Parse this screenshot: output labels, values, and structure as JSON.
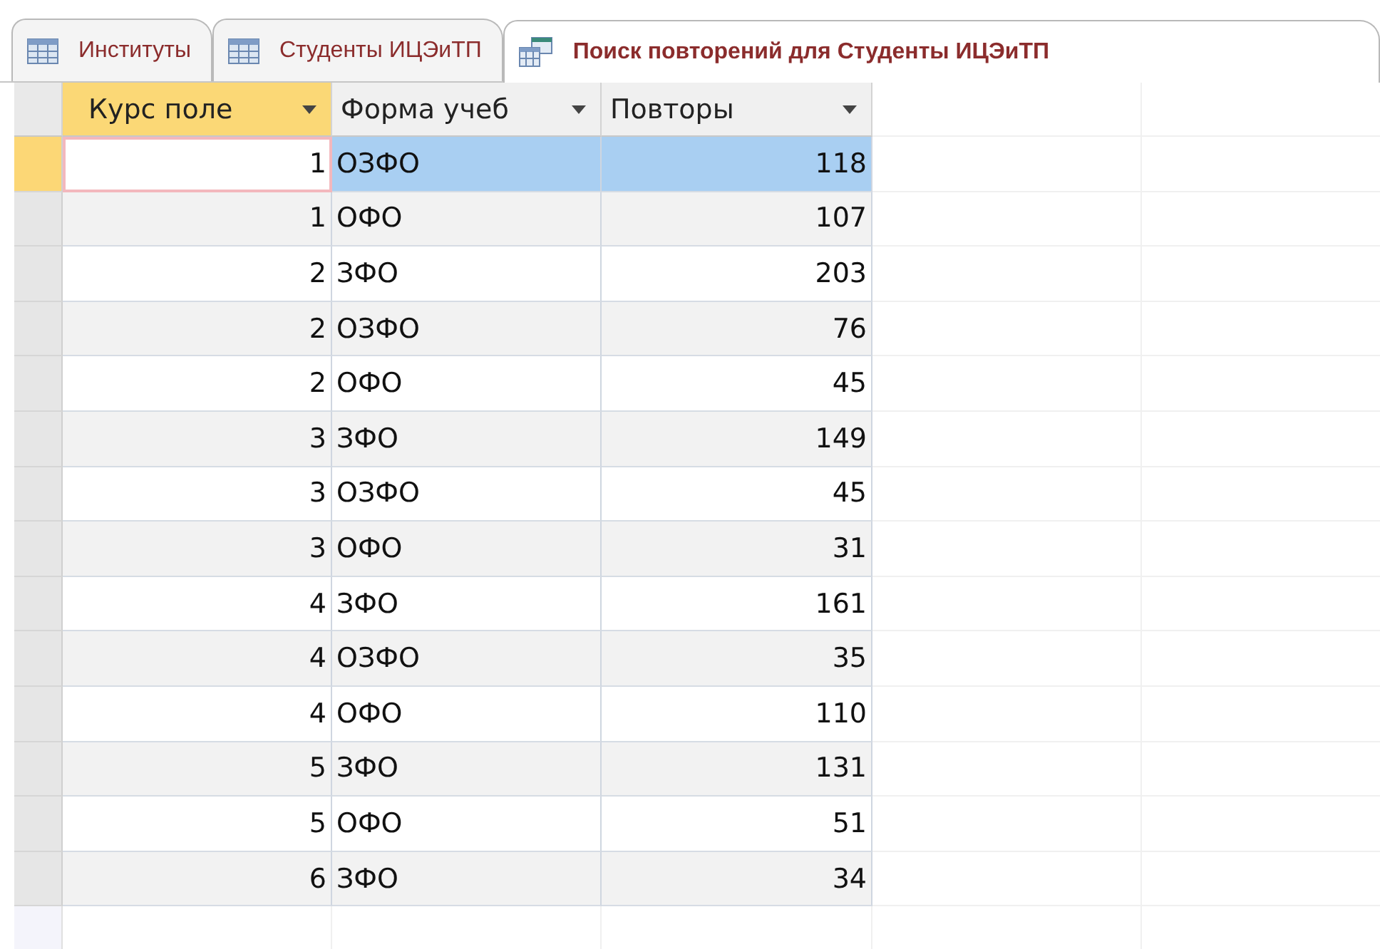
{
  "tabs": [
    {
      "label": "Институты",
      "kind": "table",
      "selected": false
    },
    {
      "label": "Студенты ИЦЭиТП",
      "kind": "table",
      "selected": false
    },
    {
      "label": "Поиск повторений для Студенты ИЦЭиТП",
      "kind": "query",
      "selected": true
    }
  ],
  "table": {
    "columns": [
      {
        "label": "Курс поле",
        "selected": true
      },
      {
        "label": "Форма учеб",
        "selected": false
      },
      {
        "label": "Повторы",
        "selected": false
      }
    ],
    "rows": [
      {
        "cells": [
          "1",
          "ОЗФО",
          "118"
        ],
        "selected": true
      },
      {
        "cells": [
          "1",
          "ОФО",
          "107"
        ],
        "selected": false
      },
      {
        "cells": [
          "2",
          "ЗФО",
          "203"
        ],
        "selected": false
      },
      {
        "cells": [
          "2",
          "ОЗФО",
          "76"
        ],
        "selected": false
      },
      {
        "cells": [
          "2",
          "ОФО",
          "45"
        ],
        "selected": false
      },
      {
        "cells": [
          "3",
          "ЗФО",
          "149"
        ],
        "selected": false
      },
      {
        "cells": [
          "3",
          "ОЗФО",
          "45"
        ],
        "selected": false
      },
      {
        "cells": [
          "3",
          "ОФО",
          "31"
        ],
        "selected": false
      },
      {
        "cells": [
          "4",
          "ЗФО",
          "161"
        ],
        "selected": false
      },
      {
        "cells": [
          "4",
          "ОЗФО",
          "35"
        ],
        "selected": false
      },
      {
        "cells": [
          "4",
          "ОФО",
          "110"
        ],
        "selected": false
      },
      {
        "cells": [
          "5",
          "ЗФО",
          "131"
        ],
        "selected": false
      },
      {
        "cells": [
          "5",
          "ОФО",
          "51"
        ],
        "selected": false
      },
      {
        "cells": [
          "6",
          "ЗФО",
          "34"
        ],
        "selected": false
      }
    ]
  }
}
